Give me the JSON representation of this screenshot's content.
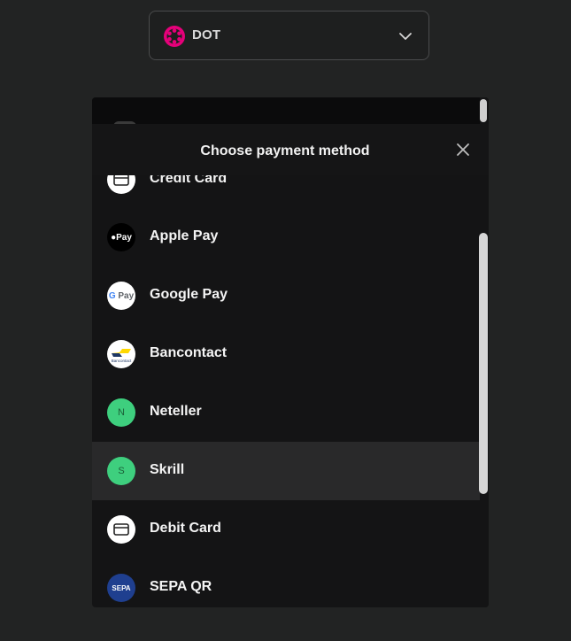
{
  "currency_selector": {
    "label": "DOT",
    "icon": "polkadot-logo",
    "chevron": "chevron-down-icon"
  },
  "modal": {
    "title": "Choose payment method",
    "close_icon": "close-icon"
  },
  "payment_methods": [
    {
      "label": "Credit Card",
      "icon": "credit-card-icon"
    },
    {
      "label": "Apple Pay",
      "icon": "apple-pay-logo",
      "logo_text": "Pay"
    },
    {
      "label": "Google Pay",
      "icon": "google-pay-logo",
      "logo_text": "Pay"
    },
    {
      "label": "Bancontact",
      "icon": "bancontact-logo",
      "logo_text": "Bancontact"
    },
    {
      "label": "Neteller",
      "icon": "neteller-logo",
      "badge_letter": "N"
    },
    {
      "label": "Skrill",
      "icon": "skrill-logo",
      "badge_letter": "S"
    },
    {
      "label": "Debit Card",
      "icon": "debit-card-icon"
    },
    {
      "label": "SEPA QR",
      "icon": "sepa-logo",
      "logo_text": "SEPA"
    }
  ],
  "colors": {
    "background": "#222323",
    "panel": "#141415",
    "highlight_row": "#29292a",
    "badge_green": "#3ecf7e",
    "polkadot_pink": "#e6007a"
  }
}
